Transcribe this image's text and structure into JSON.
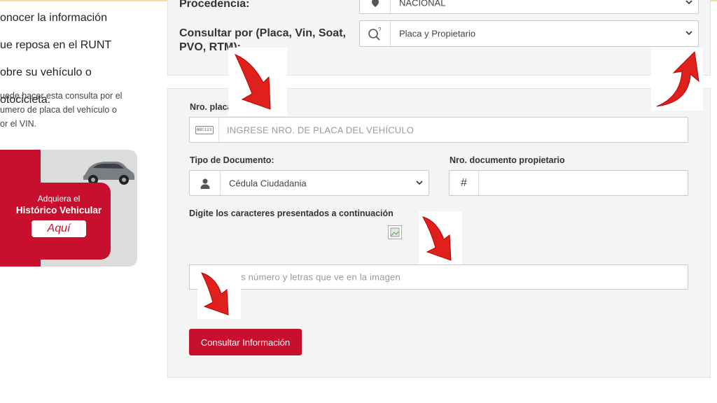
{
  "left": {
    "intro_lines": [
      "onocer la información",
      "ue reposa en el RUNT",
      "obre su vehículo o",
      "otocicleta."
    ],
    "sub_lines": [
      "uede hacer esta consulta por el",
      "umero de placa del vehículo o",
      "or el VIN."
    ],
    "promo": {
      "line1": "Adquiera el",
      "line2": "Histórico Vehicular",
      "button": "Aquí"
    }
  },
  "form": {
    "procedencia_label": "Procedencia:",
    "procedencia_value": "NACIONAL",
    "consultar_label": "Consultar por (Placa, Vin, Soat, PVO, RTM):",
    "consultar_value": "Placa y Propietario",
    "placa_label": "Nro. placa",
    "placa_placeholder": "INGRESE NRO. DE PLACA DEL VEHÍCULO",
    "placa_icon_text": "ABC123",
    "tipo_doc_label": "Tipo de Documento:",
    "tipo_doc_value": "Cédula Ciudadania",
    "nro_doc_label": "Nro. documento propietario",
    "nro_doc_prefix": "#",
    "captcha_label": "Digite los caracteres presentados a continuación",
    "captcha_placeholder": "Ingrese los número y letras que ve en la imagen",
    "submit_label": "Consultar Información"
  },
  "icons": {
    "location": "map-marker-icon",
    "search_type": "search-question-icon",
    "user": "user-icon",
    "plate": "license-plate-icon",
    "chevron": "chevron-down-icon",
    "arrow": "red-arrow-icon"
  },
  "colors": {
    "brand_red": "#c8102e",
    "panel_bg": "#f4f4f4",
    "border": "#c9c9c9"
  }
}
